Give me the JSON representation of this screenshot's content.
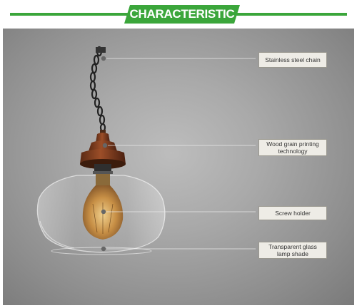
{
  "header": {
    "title": "CHARACTERISTIC",
    "accent_color": "#3ba63b"
  },
  "callouts": [
    {
      "label": "Stainless steel chain"
    },
    {
      "label": "Wood grain printing technology"
    },
    {
      "label": "Screw holder"
    },
    {
      "label": "Transparent glass lamp shade"
    }
  ]
}
